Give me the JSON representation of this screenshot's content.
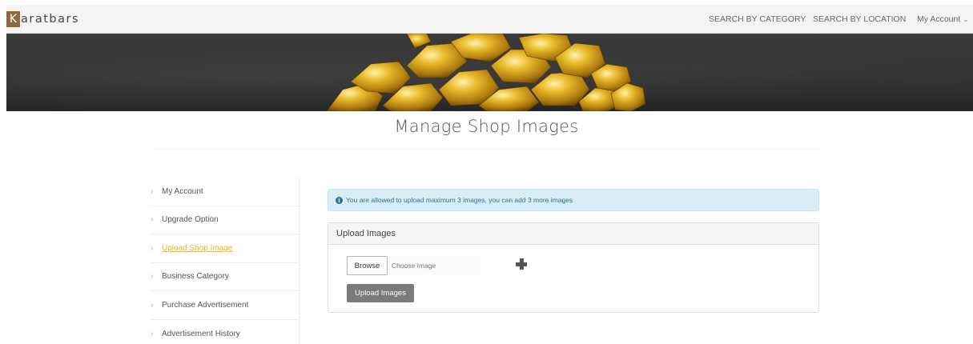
{
  "brand": {
    "first_letter": "K",
    "rest": "aratbars"
  },
  "nav": {
    "search_category": "SEARCH BY CATEGORY",
    "search_location": "SEARCH BY LOCATION",
    "my_account": "My Account"
  },
  "page": {
    "title": "Manage Shop Images"
  },
  "sidebar": {
    "items": [
      {
        "label": "My Account"
      },
      {
        "label": "Upgrade Option"
      },
      {
        "label": "Upload Shop Image"
      },
      {
        "label": "Business Category"
      },
      {
        "label": "Purchase Advertisement"
      },
      {
        "label": "Advertisement History"
      }
    ],
    "active_index": 2
  },
  "alert": {
    "message": "You are allowed to upload maximum 3 images, you can add 3 more images"
  },
  "upload_panel": {
    "heading": "Upload Images",
    "browse_label": "Browse",
    "file_placeholder": "Choose Image",
    "upload_button": "Upload Images"
  },
  "icons": {
    "sidebar_item": "chevron-right-icon",
    "alert": "info-circle-icon",
    "add_file": "plus-icon",
    "account_caret": "chevron-down-icon"
  },
  "colors": {
    "brand_accent": "#8a6a3f",
    "active_link": "#f0b31a",
    "alert_bg": "#d9edf7",
    "alert_text": "#31708f",
    "upload_button_bg": "#7a7a7a"
  }
}
